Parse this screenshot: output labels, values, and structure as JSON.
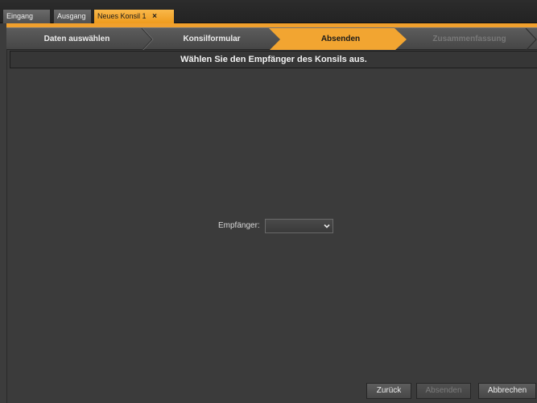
{
  "tabs": [
    {
      "label": "Eingang"
    },
    {
      "label": "Ausgang"
    },
    {
      "label": "Neues Konsil 1",
      "close": "×",
      "active": true
    }
  ],
  "wizard": {
    "steps": [
      {
        "label": "Daten auswählen",
        "state": "done"
      },
      {
        "label": "Konsilformular",
        "state": "done"
      },
      {
        "label": "Absenden",
        "state": "active"
      },
      {
        "label": "Zusammenfassung",
        "state": "disabled"
      }
    ]
  },
  "main": {
    "instruction": "Wählen Sie den Empfänger des Konsils aus.",
    "recipient_label": "Empfänger:",
    "recipient_value": ""
  },
  "footer": {
    "back_label": "Zurück",
    "send_label": "Absenden",
    "cancel_label": "Abbrechen"
  },
  "colors": {
    "accent": "#f0a02d",
    "background": "#3b3b3b"
  }
}
